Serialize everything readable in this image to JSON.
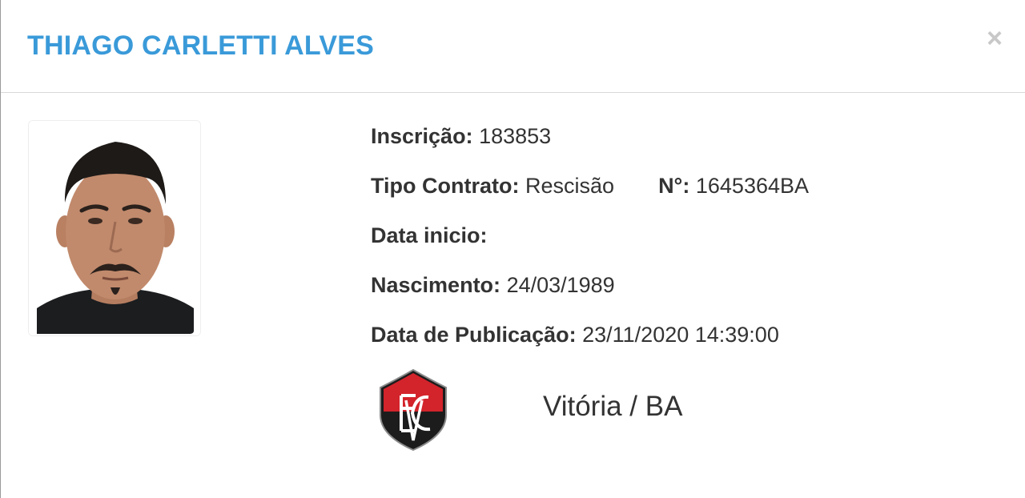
{
  "player": {
    "name": "THIAGO CARLETTI ALVES"
  },
  "close_icon": "close-icon",
  "colors": {
    "title": "#3a9ad9",
    "text": "#333333",
    "close": "#c8c8c8",
    "club_red": "#d3232b",
    "club_black": "#1c1c1c"
  },
  "details": {
    "inscricao_label": "Inscrição:",
    "inscricao_value": "183853",
    "tipo_contrato_label": "Tipo Contrato:",
    "tipo_contrato_value": "Rescisão",
    "numero_label": "N°:",
    "numero_value": "1645364BA",
    "data_inicio_label": "Data inicio:",
    "data_inicio_value": "",
    "nascimento_label": "Nascimento:",
    "nascimento_value": "24/03/1989",
    "publicacao_label": "Data de Publicação:",
    "publicacao_value": "23/11/2020 14:39:00"
  },
  "club": {
    "name": "Vitória / BA",
    "crest": "club-crest-icon"
  }
}
